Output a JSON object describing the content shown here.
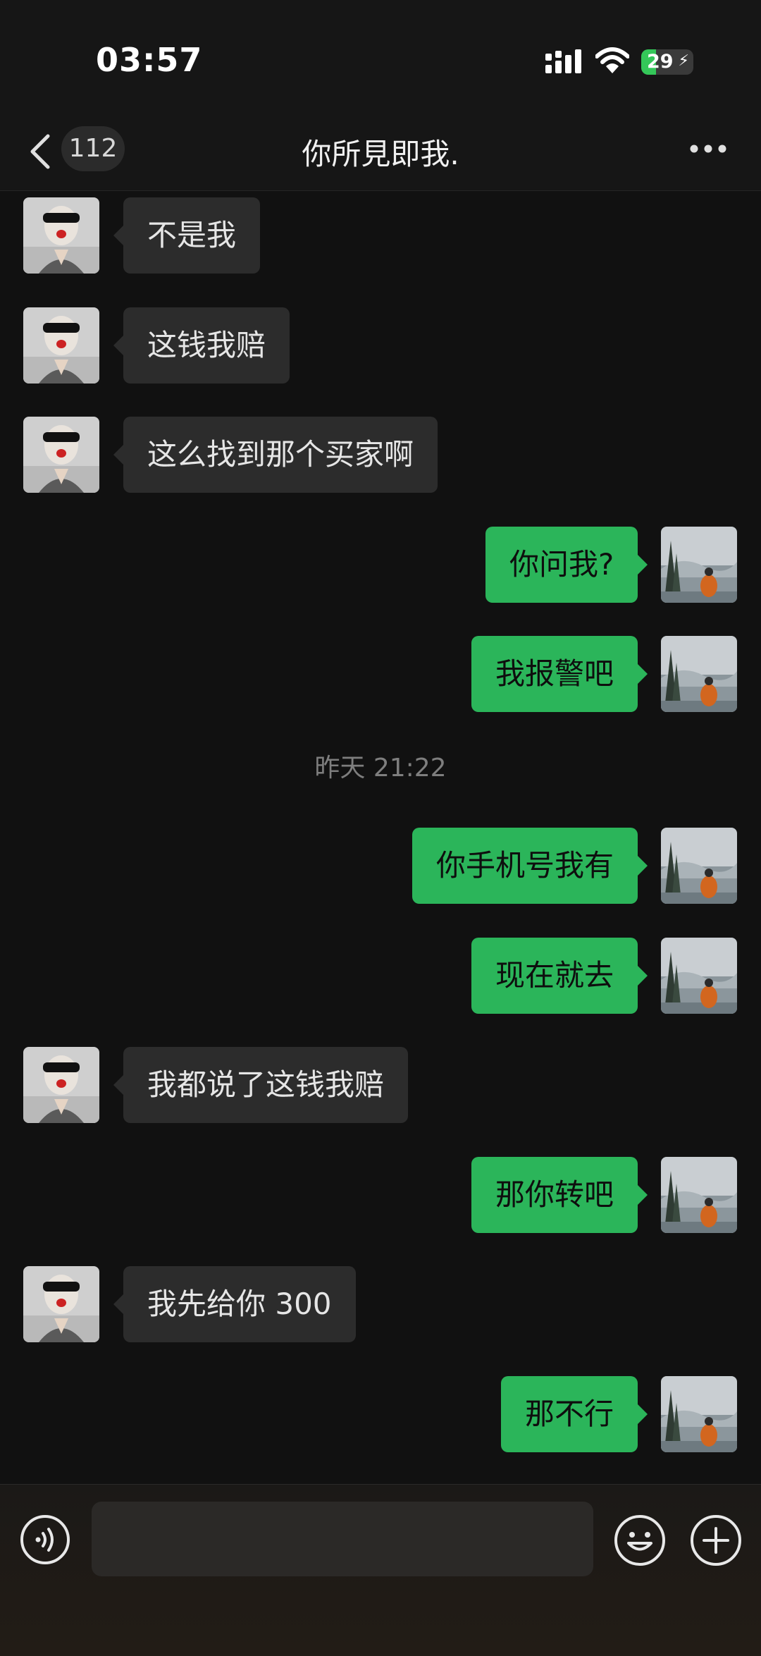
{
  "status": {
    "time": "03:57",
    "battery": "29",
    "battery_level": 0.29
  },
  "header": {
    "back_count": "112",
    "title": "你所見即我."
  },
  "messages": [
    {
      "side": "in",
      "text": "不是我"
    },
    {
      "side": "in",
      "text": "这钱我赔"
    },
    {
      "side": "in",
      "text": "这么找到那个买家啊"
    },
    {
      "side": "out",
      "text": "你问我?"
    },
    {
      "side": "out",
      "text": "我报警吧"
    },
    {
      "type": "time",
      "text": "昨天 21:22"
    },
    {
      "side": "out",
      "text": "你手机号我有"
    },
    {
      "side": "out",
      "text": "现在就去"
    },
    {
      "side": "in",
      "text": "我都说了这钱我赔"
    },
    {
      "side": "out",
      "text": "那你转吧"
    },
    {
      "side": "in",
      "text": "我先给你 300"
    },
    {
      "side": "out",
      "text": "那不行"
    }
  ],
  "input": {
    "value": ""
  },
  "icons": {
    "back": "chevron-left-icon",
    "more": "more-dots-icon",
    "voice": "voice-icon",
    "emoji": "emoji-icon",
    "plus": "plus-icon"
  },
  "colors": {
    "out_bubble": "#2bb55a",
    "in_bubble": "#2c2c2c",
    "background": "#111111"
  }
}
